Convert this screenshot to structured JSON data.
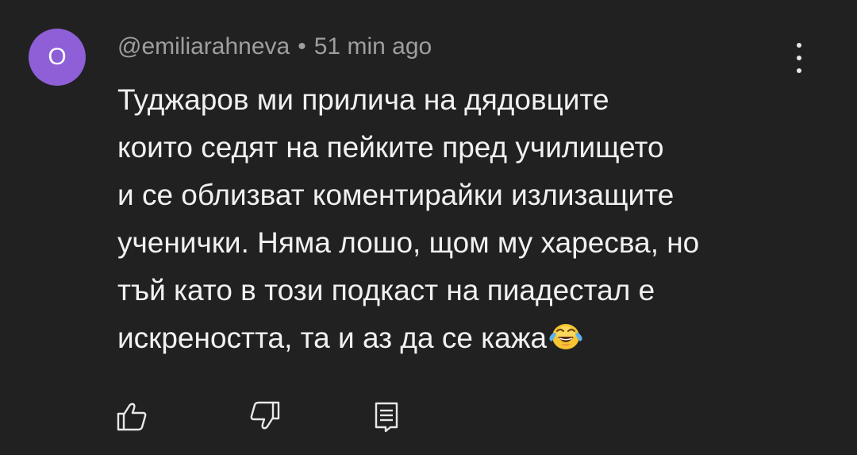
{
  "comment": {
    "avatar_letter": "O",
    "avatar_color": "#8e5fd6",
    "author": "@emiliarahneva",
    "separator": "•",
    "time": "51 min ago",
    "text_lines": [
      "Туджаров ми прилича на дядовците",
      "които седят на пейките пред училището",
      "и се облизват коментирайки излизащите",
      "ученички. Няма лошо, щом му харесва, но",
      "тъй като в този подкаст на пиадестал е",
      "искреността, та и аз да се кажа"
    ],
    "emoji": "face-with-tears-of-joy-icon"
  },
  "actions": {
    "like": "thumb-up-icon",
    "dislike": "thumb-down-icon",
    "reply": "reply-comment-icon"
  },
  "colors": {
    "background": "#212121",
    "text": "#f1f1f1",
    "meta": "#9e9e9e",
    "icons": "#e8e8e8"
  }
}
